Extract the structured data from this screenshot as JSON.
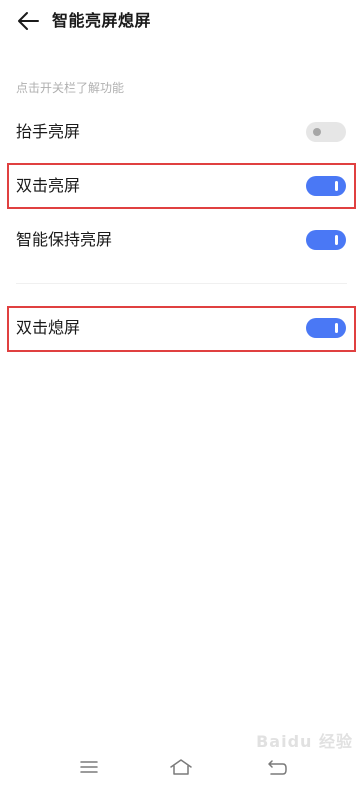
{
  "header": {
    "title": "智能亮屏熄屏",
    "back_icon": "back-arrow-icon"
  },
  "hint": "点击开关栏了解功能",
  "settings": [
    {
      "label": "抬手亮屏",
      "on": false
    },
    {
      "label": "双击亮屏",
      "on": true
    },
    {
      "label": "智能保持亮屏",
      "on": true
    },
    {
      "label": "双击熄屏",
      "on": true
    }
  ],
  "navbar": {
    "menu_icon": "menu-icon",
    "home_icon": "home-icon",
    "back_icon": "return-icon"
  },
  "watermark": "Baidu 经验",
  "colors": {
    "toggle_on": "#4a78f5",
    "toggle_off": "#e6e6e6",
    "highlight": "#e04040"
  }
}
